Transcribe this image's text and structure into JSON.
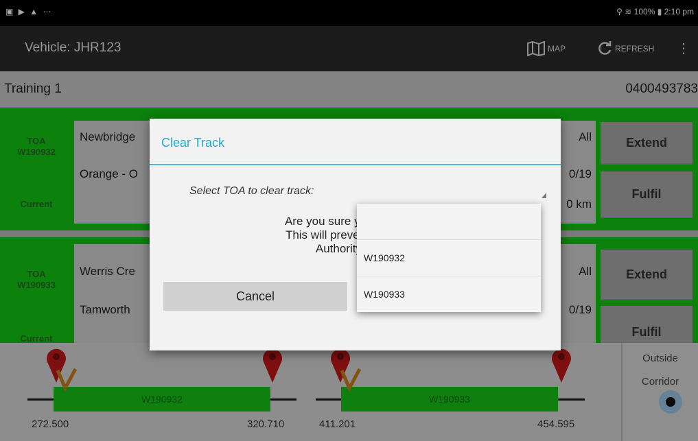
{
  "status_bar": {
    "left_icons": "▣ ▶ ▲ ⋯",
    "right_text": "⚲ ≋ 100% ▮ 2:10 pm"
  },
  "action_bar": {
    "title": "Vehicle: JHR123",
    "map_label": "MAP",
    "refresh_label": "REFRESH",
    "overflow": "⋮"
  },
  "info_bar": {
    "name": "Training 1",
    "phone": "0400493783"
  },
  "cards": [
    {
      "toa_label": "TOA",
      "toa_id": "W190932",
      "state": "Current",
      "line1": "Newbridge",
      "line2": "Orange - O",
      "r1": "All",
      "r2": "0/19",
      "r3": "0 km",
      "btn1": "Extend",
      "btn2": "Fulfil"
    },
    {
      "toa_label": "TOA",
      "toa_id": "W190933",
      "state": "Current",
      "line1": "Werris Cre",
      "line2": "Tamworth",
      "r1": "All",
      "r2": "0/19",
      "btn1": "Extend",
      "btn2": "Fulfil"
    }
  ],
  "map_strip": {
    "segments": [
      {
        "label": "W190932",
        "start_km": "272.500",
        "end_km": "320.710"
      },
      {
        "label": "W190933",
        "start_km": "411.201",
        "end_km": "454.595"
      }
    ],
    "outside_label_1": "Outside",
    "outside_label_2": "Corridor"
  },
  "dialog": {
    "title": "Clear Track",
    "select_label": "Select TOA to clear track:",
    "message_line1": "Are you sure you want to cl",
    "message_line2": "This will prevent you from r",
    "message_line3": "Authority Alarm",
    "cancel_label": "Cancel"
  },
  "dropdown": {
    "options": [
      "",
      "W190932",
      "W190933"
    ]
  },
  "colors": {
    "accent": "#2aa7c8",
    "card_green": "#13c713",
    "action_bar": "#2b2b2b"
  }
}
